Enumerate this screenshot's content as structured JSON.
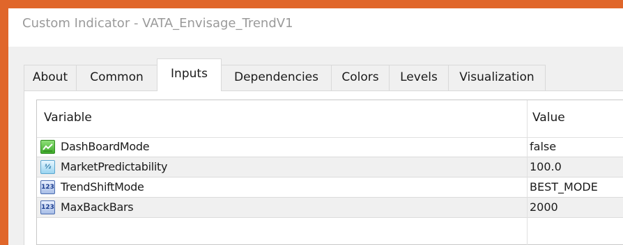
{
  "window": {
    "title": "Custom Indicator - VATA_Envisage_TrendV1"
  },
  "tabs": [
    {
      "label": "About",
      "active": false
    },
    {
      "label": "Common",
      "active": false
    },
    {
      "label": "Inputs",
      "active": true
    },
    {
      "label": "Dependencies",
      "active": false
    },
    {
      "label": "Colors",
      "active": false
    },
    {
      "label": "Levels",
      "active": false
    },
    {
      "label": "Visualization",
      "active": false
    }
  ],
  "grid": {
    "columns": {
      "variable": "Variable",
      "value": "Value"
    },
    "rows": [
      {
        "icon": "bool-icon",
        "icon_text": "",
        "name": "DashBoardMode",
        "value": "false"
      },
      {
        "icon": "double-icon",
        "icon_text": "½",
        "name": "MarketPredictability",
        "value": "100.0"
      },
      {
        "icon": "int-icon",
        "icon_text": "123",
        "name": "TrendShiftMode",
        "value": "BEST_MODE"
      },
      {
        "icon": "int-icon",
        "icon_text": "123",
        "name": "MaxBackBars",
        "value": "2000"
      }
    ]
  },
  "colors": {
    "background": "#e0662a",
    "title_text": "#9a9a9a",
    "dialog_bg": "#f0f0f0"
  }
}
